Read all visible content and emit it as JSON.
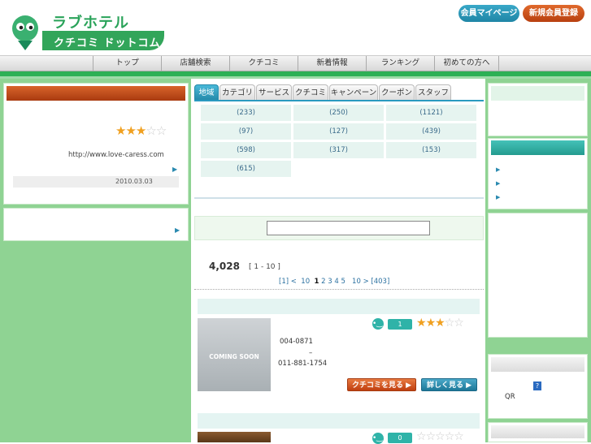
{
  "logo": {
    "title": "ラブホテル",
    "subtitle": "クチコミ ドットコム"
  },
  "header_buttons": {
    "mypage": "会員マイページ",
    "register": "新規会員登録"
  },
  "nav": [
    "トップ",
    "店舗検索",
    "クチコミ",
    "新着情報",
    "ランキング",
    "初めての方へ"
  ],
  "left": {
    "featured": {
      "rating": 3,
      "url": "http://www.love-caress.com",
      "date": "2010.03.03",
      "arrow": "▶"
    },
    "panel2": {
      "arrow": "▶"
    }
  },
  "tabs": [
    "地域",
    "カテゴリ",
    "サービス",
    "クチコミ",
    "キャンペーン",
    "クーポン",
    "スタッフ"
  ],
  "region_counts": [
    "(233)",
    "(250)",
    "(1121)",
    "(97)",
    "(127)",
    "(439)",
    "(598)",
    "(317)",
    "(153)",
    "(615)"
  ],
  "search": {
    "value": ""
  },
  "results": {
    "total": "4,028",
    "range": "[ 1 - 10 ]",
    "pager": {
      "first": "[1]",
      "prev": "<",
      "ten_back": "10",
      "current": "1",
      "pages": [
        "2",
        "3",
        "4",
        "5"
      ],
      "ten_next": "10",
      "next": ">",
      "last": "[403]"
    }
  },
  "items": [
    {
      "comments": "1",
      "rating": 3,
      "placeholder": "COMING SOON",
      "zip": "004-0871",
      "dash": "–",
      "tel": "011-881-1754",
      "btn_kuchikomi": "クチコミを見る ▶",
      "btn_detail": "詳しく見る ▶"
    },
    {
      "comments": "0",
      "rating": 0
    }
  ],
  "right": {
    "arrows": [
      "▶",
      "▶",
      "▶"
    ],
    "qr_label": "QR",
    "qr_icon": "?"
  },
  "colors": {
    "green": "#2db055",
    "orange": "#c04010",
    "teal": "#2fb3a8",
    "star": "#f0a020"
  }
}
